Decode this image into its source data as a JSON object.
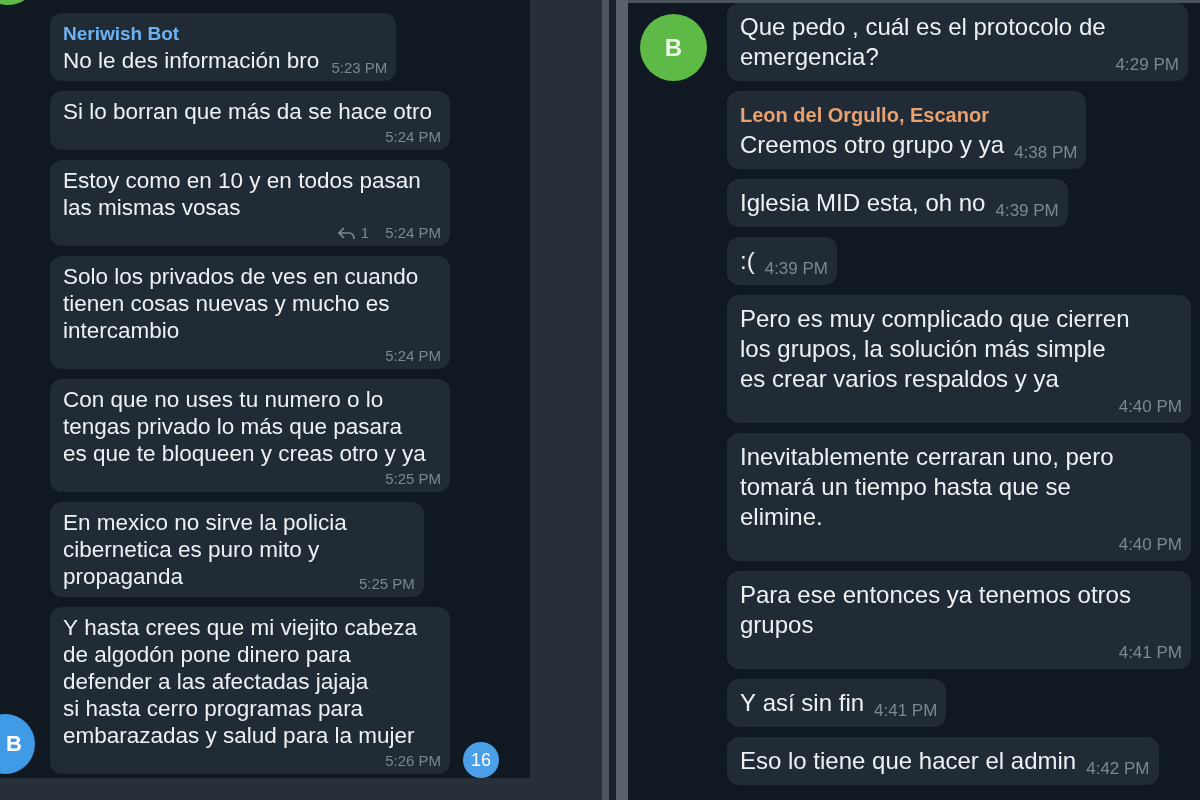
{
  "panels": [
    {
      "avatar_above": {
        "color": "#5cb94a"
      },
      "messages": [
        {
          "sender": {
            "name": "Neriwish Bot",
            "color": "#6db3f2"
          },
          "text": "No le des información bro",
          "time": "5:23 PM"
        },
        {
          "text": "Si lo borran que más da se hace otro",
          "time": "5:24 PM"
        },
        {
          "text": "Estoy como en 10 y en todos pasan\nlas mismas vosas",
          "replies": "1",
          "time": "5:24 PM"
        },
        {
          "text": "Solo los privados de ves en cuando\ntienen cosas nuevas y mucho es\nintercambio",
          "time": "5:24 PM"
        },
        {
          "text": "Con que no uses tu numero o lo\ntengas privado lo más que pasara\nes que te bloqueen y creas otro y ya",
          "time": "5:25 PM"
        },
        {
          "text": "En mexico no sirve la policia\ncibernetica es puro mito y\npropaganda",
          "time": "5:25 PM"
        },
        {
          "text": "Y hasta crees que mi viejito cabeza\nde algodón pone dinero para\ndefender a las afectadas jajaja\nsi hasta cerro programas para\nembarazadas y salud para la mujer",
          "time": "5:26 PM",
          "avatar": {
            "initials": "B",
            "color": "#3f9be6"
          }
        }
      ],
      "unread_badge": "16"
    },
    {
      "messages": [
        {
          "text": "Que pedo , cuál es el protocolo de\nemergencia?",
          "time": "4:29 PM",
          "avatar": {
            "initials": "B",
            "color": "#5dba47"
          }
        },
        {
          "sender": {
            "name": "Leon del Orgullo, Escanor",
            "color": "#e8a272"
          },
          "text": "Creemos otro grupo y ya",
          "time": "4:38 PM"
        },
        {
          "text": "Iglesia MID esta, oh no",
          "time": "4:39 PM"
        },
        {
          "text": ":(",
          "time": "4:39 PM"
        },
        {
          "text": "Pero es muy complicado que cierren\nlos grupos, la solución más simple\nes crear varios respaldos y ya",
          "time": "4:40 PM"
        },
        {
          "text": "Inevitablemente cerraran uno, pero\ntomará un tiempo hasta que se\nelimine.",
          "time": "4:40 PM"
        },
        {
          "text": "Para ese entonces ya tenemos otros\ngrupos",
          "time": "4:41 PM"
        },
        {
          "text": "Y así sin fin",
          "time": "4:41 PM"
        },
        {
          "text": "Eso lo tiene que hacer el admin",
          "time": "4:42 PM"
        }
      ]
    }
  ]
}
